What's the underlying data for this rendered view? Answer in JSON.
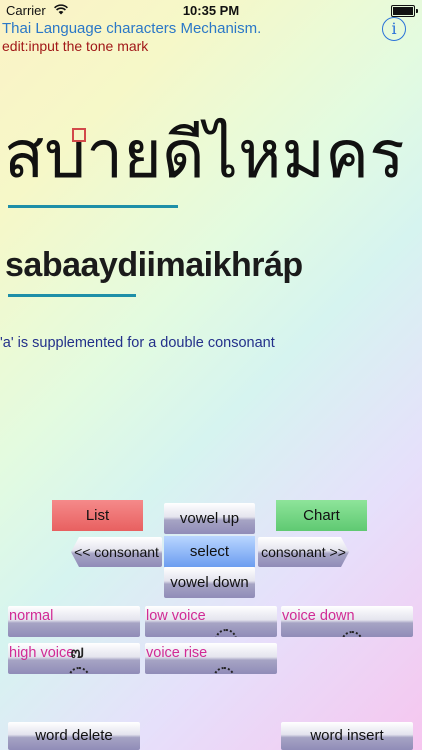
{
  "status_bar": {
    "carrier": "Carrier",
    "time": "10:35 PM"
  },
  "header": {
    "title": "Thai Language characters Mechanism.",
    "mode": "edit:input the tone mark",
    "info_label": "i"
  },
  "word": {
    "thai": "สบายดีไหมคร",
    "romanized": "sabaaydiimaikhráp"
  },
  "note": "'a' is supplemented for a double consonant",
  "controls": {
    "list": "List",
    "chart": "Chart",
    "vowel_up": "vowel up",
    "vowel_down": "vowel down",
    "select": "select",
    "consonant_prev": "<< consonant",
    "consonant_next": "consonant >>"
  },
  "tones": [
    {
      "label": "normal",
      "mark": ""
    },
    {
      "label": "low voice",
      "mark": "่"
    },
    {
      "label": "voice down",
      "mark": "้"
    },
    {
      "label": "high voice",
      "mark": "๗"
    },
    {
      "label": "voice rise",
      "mark": "๋"
    }
  ],
  "actions": {
    "delete": "word delete",
    "insert": "word insert"
  },
  "colors": {
    "title": "#2b78c7",
    "mode": "#a11818",
    "note": "#23308a",
    "tone_label": "#d12b95",
    "underline": "#1e8fa8",
    "list_button": "#e86060",
    "chart_button": "#5fc972",
    "select_button": "#6c9df0"
  }
}
